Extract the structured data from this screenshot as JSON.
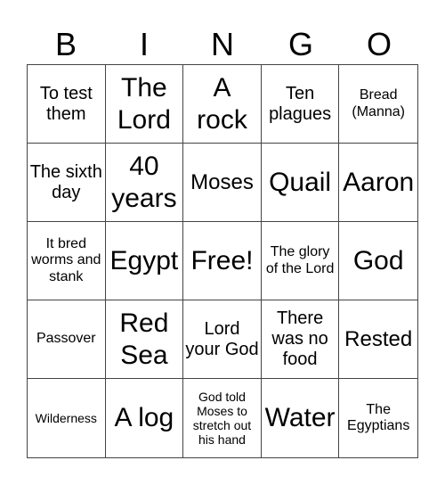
{
  "header": {
    "letters": [
      "B",
      "I",
      "N",
      "G",
      "O"
    ]
  },
  "cells": [
    {
      "text": "To test them",
      "size": "m"
    },
    {
      "text": "The Lord",
      "size": "xl"
    },
    {
      "text": "A rock",
      "size": "xl"
    },
    {
      "text": "Ten plagues",
      "size": "m"
    },
    {
      "text": "Bread (Manna)",
      "size": "s"
    },
    {
      "text": "The sixth day",
      "size": "m"
    },
    {
      "text": "40 years",
      "size": "xl"
    },
    {
      "text": "Moses",
      "size": "l"
    },
    {
      "text": "Quail",
      "size": "xl"
    },
    {
      "text": "Aaron",
      "size": "xl"
    },
    {
      "text": "It bred worms and stank",
      "size": "s"
    },
    {
      "text": "Egypt",
      "size": "xl"
    },
    {
      "text": "Free!",
      "size": "xl"
    },
    {
      "text": "The glory of the Lord",
      "size": "s"
    },
    {
      "text": "God",
      "size": "xl"
    },
    {
      "text": "Passover",
      "size": "s"
    },
    {
      "text": "Red Sea",
      "size": "xl"
    },
    {
      "text": "Lord your God",
      "size": "m"
    },
    {
      "text": "There was no food",
      "size": "m"
    },
    {
      "text": "Rested",
      "size": "l"
    },
    {
      "text": "Wilderness",
      "size": "xs"
    },
    {
      "text": "A log",
      "size": "xl"
    },
    {
      "text": "God told Moses to stretch out his hand",
      "size": "xs"
    },
    {
      "text": "Water",
      "size": "xl"
    },
    {
      "text": "The Egyptians",
      "size": "s"
    }
  ]
}
